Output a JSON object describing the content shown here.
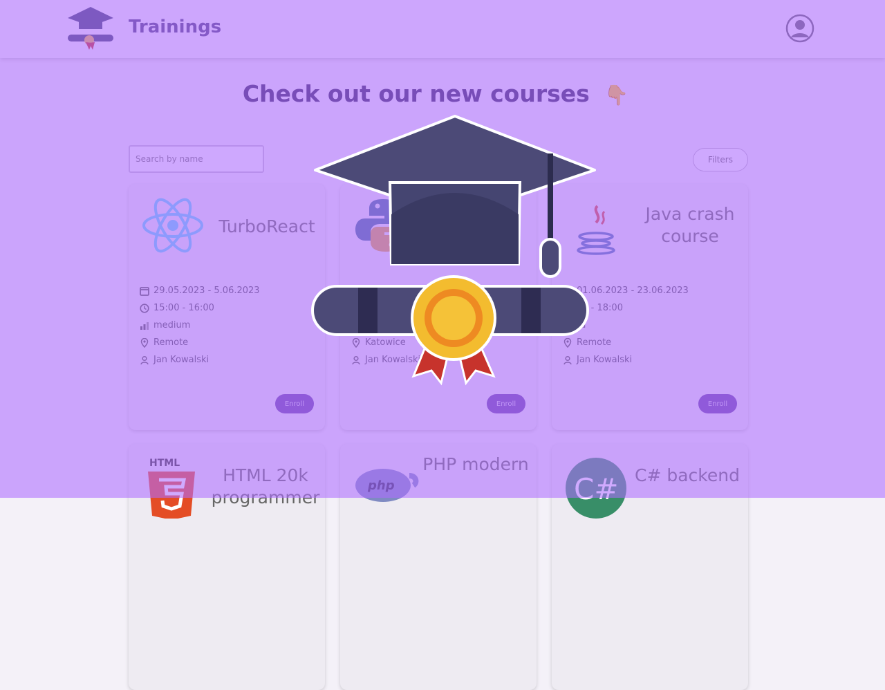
{
  "header": {
    "title": "Trainings"
  },
  "main": {
    "headline": "Check out our new courses",
    "emoji": "👇",
    "search_placeholder": "Search by name",
    "filters_label": "Filters"
  },
  "cards": [
    {
      "title": "TurboReact",
      "dates": "29.05.2023 - 5.06.2023",
      "time": "15:00 - 16:00",
      "level": "medium",
      "location": "Remote",
      "instructor": "Jan Kowalski",
      "enroll": "Enroll"
    },
    {
      "location": "Katowice",
      "instructor": "Jan Kowalski",
      "enroll": "Enroll"
    },
    {
      "title": "Java crash course",
      "dates": "01.06.2023 - 23.06.2023",
      "time": "00 - 18:00",
      "level": "rd",
      "location": "Remote",
      "instructor": "Jan Kowalski",
      "enroll": "Enroll"
    }
  ],
  "lower_cards": [
    {
      "title": "HTML 20k programmer"
    },
    {
      "title": "PHP modern"
    },
    {
      "title": "C# backend"
    }
  ],
  "colors": {
    "overlay": "#ae6cff",
    "accent": "#6640a7",
    "title_text": "#2e2256",
    "react_blue": "#61dafb"
  },
  "icons": {
    "logo": "graduation-cap-icon",
    "avatar": "user-icon",
    "card_logos": [
      "react-icon",
      "python-icon",
      "java-icon",
      "html5-icon",
      "php-icon",
      "csharp-icon"
    ]
  }
}
